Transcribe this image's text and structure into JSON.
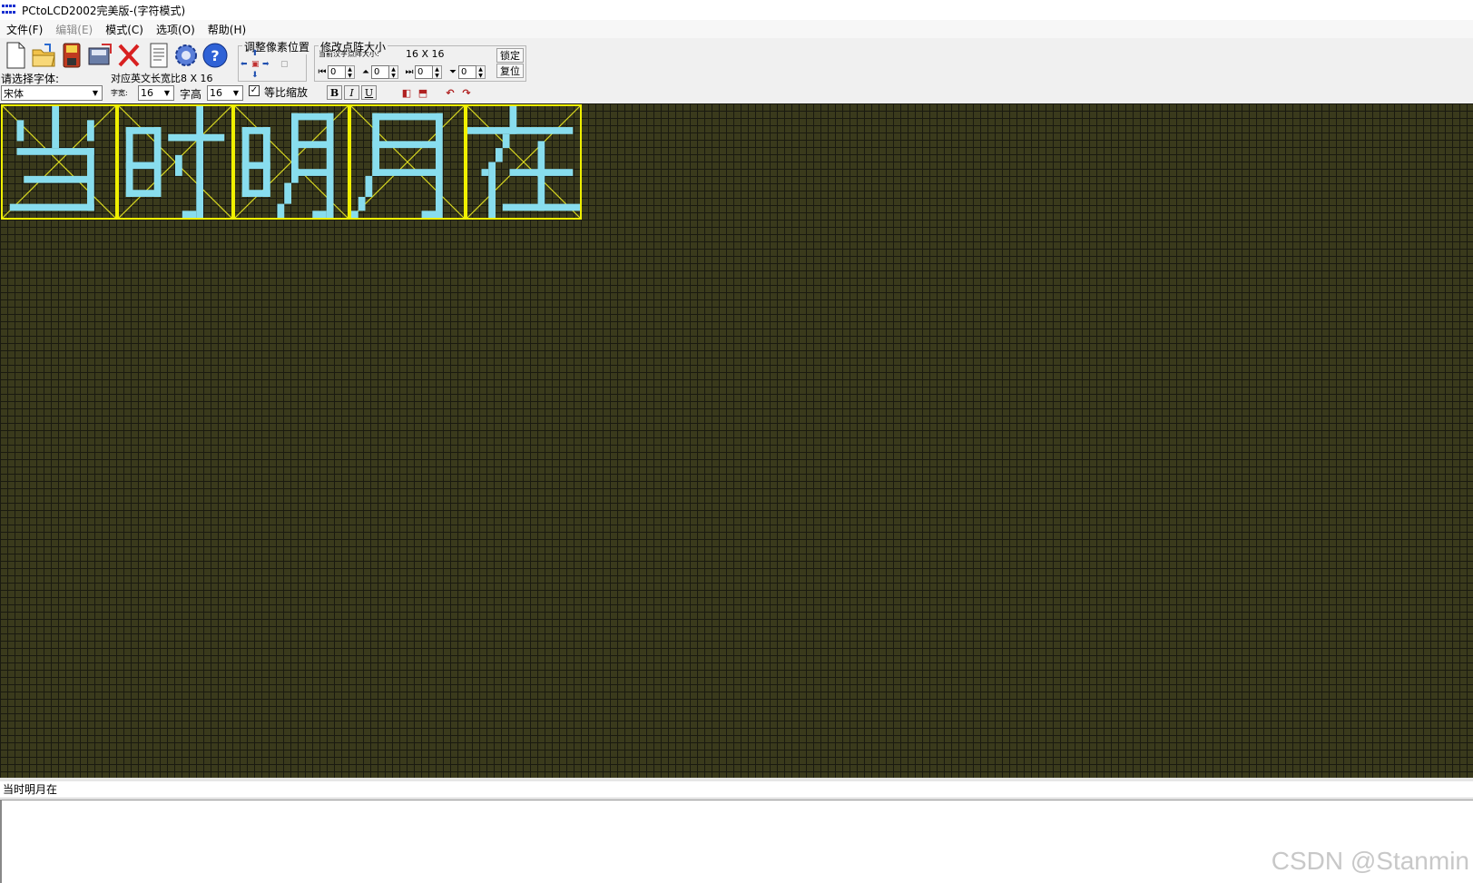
{
  "window": {
    "title": "PCtoLCD2002完美版-(字符模式)"
  },
  "menu": [
    {
      "label": "文件(F)",
      "disabled": false
    },
    {
      "label": "编辑(E)",
      "disabled": true
    },
    {
      "label": "模式(C)",
      "disabled": false
    },
    {
      "label": "选项(O)",
      "disabled": false
    },
    {
      "label": "帮助(H)",
      "disabled": false
    }
  ],
  "toolbar": {
    "buttons": [
      "new-file",
      "open-folder",
      "save-disk",
      "save-as",
      "delete",
      "notes",
      "settings-gear",
      "help"
    ],
    "pixel_group": {
      "title": "调整像素位置"
    },
    "resize_group": {
      "title": "修改点阵大小",
      "current_label": "当前汉字点阵大小:",
      "current_size": "16 X 16",
      "lock_label": "锁定",
      "reset_label": "复位",
      "spinners": [
        "0",
        "0",
        "0",
        "0"
      ]
    }
  },
  "font_row": {
    "font_label": "请选择字体:",
    "ratio_label": "对应英文长宽比8 X 16",
    "font_value": "宋体",
    "width_label": "字宽:",
    "width_value": "16",
    "height_label": "字高",
    "height_value": "16",
    "scale_label": "等比缩放",
    "scale_checked": true,
    "bold": "B",
    "italic": "I",
    "underline": "U"
  },
  "canvas": {
    "characters": [
      "当",
      "时",
      "明",
      "月",
      "在"
    ],
    "colors": {
      "background": "#3a3a1c",
      "pixel_on": "#88ddee",
      "cell_border": "#f0f000"
    }
  },
  "input_text": "当时明月在",
  "output_text": "",
  "watermark": "CSDN @Stanmin"
}
